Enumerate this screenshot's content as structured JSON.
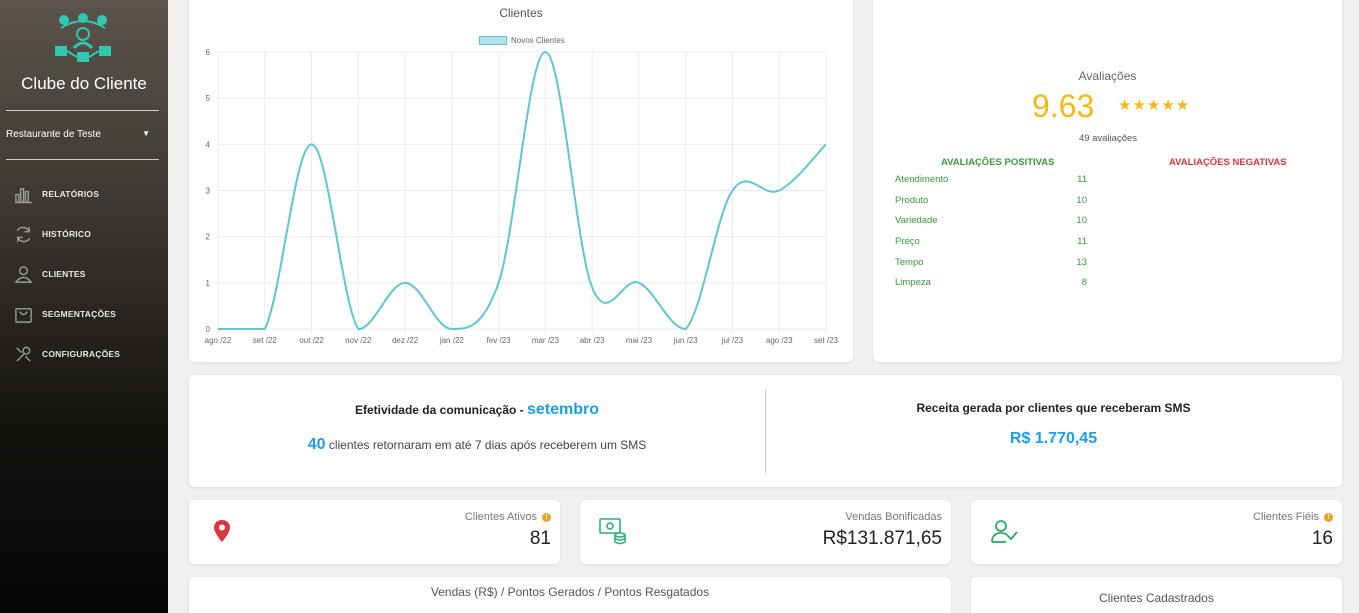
{
  "sidebar": {
    "brand": "Clube do Cliente",
    "store": "Restaurante de Teste",
    "items": [
      {
        "label": "RELATÓRIOS",
        "icon": "bar-chart-icon"
      },
      {
        "label": "HISTÓRICO",
        "icon": "refresh-icon"
      },
      {
        "label": "CLIENTES",
        "icon": "user-icon"
      },
      {
        "label": "SEGMENTAÇÕES",
        "icon": "bag-icon"
      },
      {
        "label": "CONFIGURAÇÕES",
        "icon": "tools-icon"
      }
    ]
  },
  "chart_data": {
    "type": "line",
    "title": "Clientes",
    "categories": [
      "ago /22",
      "set /22",
      "out /22",
      "nov /22",
      "dez /22",
      "jan /22",
      "fev /23",
      "mar /23",
      "abr /23",
      "mai /23",
      "jun /23",
      "jul /23",
      "ago /23",
      "set /23"
    ],
    "series": [
      {
        "name": "Novos Clientes",
        "values": [
          0,
          0,
          4,
          0,
          1,
          0,
          1,
          6,
          0.9,
          1,
          0,
          3,
          3,
          4
        ]
      }
    ],
    "ylim": [
      0,
      6
    ],
    "yticks": [
      0,
      1,
      2,
      3,
      4,
      5,
      6
    ],
    "grid": true,
    "legend": "top",
    "color": "#5ec8d0"
  },
  "ratings": {
    "title": "Avaliações",
    "score": "9.63",
    "stars": "★★★★★",
    "count": "49 avaliações",
    "positive_title": "AVALIAÇÕES POSITIVAS",
    "negative_title": "AVALIAÇÕES NEGATIVAS",
    "positive": [
      {
        "label": "Atendimento",
        "value": "11"
      },
      {
        "label": "Produto",
        "value": "10"
      },
      {
        "label": "Variedade",
        "value": "10"
      },
      {
        "label": "Preço",
        "value": "11"
      },
      {
        "label": "Tempo",
        "value": "13"
      },
      {
        "label": "Limpeza",
        "value": "8"
      }
    ]
  },
  "communication": {
    "title": "Efetividade da comunicação - ",
    "month": "setembro",
    "count": "40",
    "subtitle": " clientes retornaram em até 7 dias após receberem um SMS",
    "revenue_title": "Receita gerada por clientes que receberam SMS",
    "revenue_value": "R$ 1.770,45"
  },
  "stats": [
    {
      "label": "Clientes Ativos",
      "value": "81",
      "info": true,
      "icon": "map-pin-icon"
    },
    {
      "label": "Vendas Bonificadas",
      "value": "R$131.871,65",
      "info": false,
      "icon": "money-coins-icon"
    },
    {
      "label": "Clientes Fiéis",
      "value": "16",
      "info": true,
      "icon": "user-check-icon"
    }
  ],
  "bottom": {
    "sales_title": "Vendas (R$) / Pontos Gerados / Pontos Resgatados",
    "registered_title": "Clientes Cadastrados"
  },
  "colors": {
    "accent_blue": "#1a9fe8",
    "rating_gold": "#f5b915",
    "positive_green": "#3a9a3a",
    "negative_red": "#d9363e",
    "icon_teal": "#2fc9b0"
  }
}
